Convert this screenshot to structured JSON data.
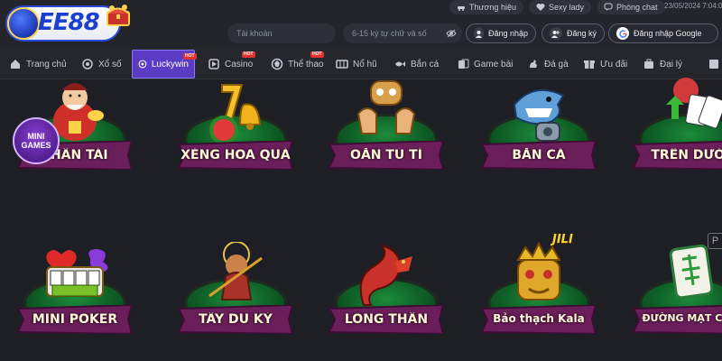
{
  "brand": {
    "name": "EE88"
  },
  "header": {
    "links": [
      {
        "label": "Thương hiệu",
        "icon": "car-icon"
      },
      {
        "label": "Sexy lady",
        "icon": "heart-icon"
      },
      {
        "label": "Phòng chat",
        "icon": "chat-icon"
      }
    ],
    "datetime": "23/05/2024 7:04:0",
    "account_placeholder": "Tài khoản",
    "password_placeholder": "6-15 ký tự chữ và số",
    "login_label": "Đăng nhập",
    "register_label": "Đăng ký",
    "google_label": "Đăng nhập Google"
  },
  "nav": {
    "items": [
      {
        "label": "Trang chủ",
        "icon": "home-icon",
        "hot": false,
        "active": false
      },
      {
        "label": "Xổ số",
        "icon": "lottery-icon",
        "hot": false,
        "active": false
      },
      {
        "label": "Luckywin",
        "icon": "luckywin-icon",
        "hot": true,
        "active": true
      },
      {
        "label": "Casino",
        "icon": "casino-icon",
        "hot": true,
        "active": false
      },
      {
        "label": "Thể thao",
        "icon": "sports-icon",
        "hot": true,
        "active": false
      },
      {
        "label": "Nổ hũ",
        "icon": "slot-icon",
        "hot": false,
        "active": false
      },
      {
        "label": "Bắn cá",
        "icon": "fish-icon",
        "hot": false,
        "active": false
      },
      {
        "label": "Game bài",
        "icon": "cards-icon",
        "hot": false,
        "active": false
      },
      {
        "label": "Đá gà",
        "icon": "rooster-icon",
        "hot": false,
        "active": false
      },
      {
        "label": "Ưu đãi",
        "icon": "gift-icon",
        "hot": false,
        "active": false
      },
      {
        "label": "Đại lý",
        "icon": "agent-icon",
        "hot": false,
        "active": false
      }
    ],
    "hot_label": "HOT"
  },
  "games": [
    {
      "label": "THẦN TÀI",
      "icon": "god-of-wealth-icon"
    },
    {
      "label": "XÈNG HOA QUẢ",
      "icon": "fruit-slot-icon"
    },
    {
      "label": "OẲN TÙ TÌ",
      "icon": "rock-paper-scissors-icon"
    },
    {
      "label": "BẮN CÁ",
      "icon": "shark-icon"
    },
    {
      "label": "TRÊN DƯỚI",
      "icon": "cards-up-down-icon"
    },
    {
      "label": "MINI POKER",
      "icon": "wild-poker-icon"
    },
    {
      "label": "TÂY DU KÝ",
      "icon": "monkey-king-icon"
    },
    {
      "label": "LONG THẦN",
      "icon": "dragon-icon"
    },
    {
      "label": "Bảo thạch Kala",
      "icon": "golden-mask-icon"
    },
    {
      "label": "ĐƯỜNG MẠT CHƯ",
      "icon": "mahjong-tile-icon"
    }
  ],
  "mini_games": {
    "line1": "MINI",
    "line2": "GAMES"
  },
  "provider_badge": "JILI",
  "side_button": "P",
  "colors": {
    "accent": "#5a3cc4",
    "banner": "#6a1e5a",
    "disc": "#1c8b3a"
  }
}
